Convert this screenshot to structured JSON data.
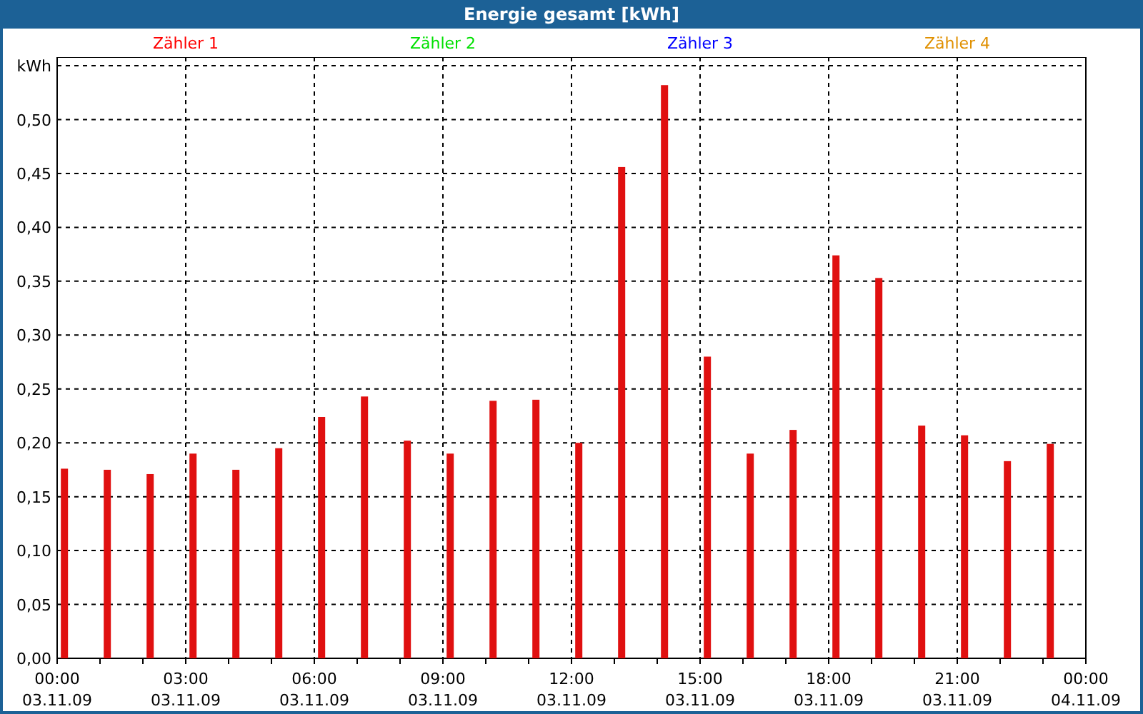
{
  "window": {
    "title": "Energie gesamt [kWh]"
  },
  "legend": [
    {
      "color": "#ff0000"
    },
    {
      "label": "Zähler 2",
      "color": "#00e000"
    },
    {
      "label": "Zähler 3",
      "color": "#0000ff"
    },
    {
      "label": "Zähler 4",
      "color": "#e09000"
    }
  ],
  "chart": {
    "chart_data": {
      "type": "bar",
      "categories": [
        "00:00 03.11.09",
        null,
        null,
        "03:00 03.11.09",
        null,
        null,
        "06:00 03.11.09",
        null,
        null,
        "09:00 03.11.09",
        null,
        null,
        "12:00 03.11.09",
        null,
        null,
        "15:00 03.11.09",
        null,
        null,
        "18:00 03.11.09",
        null,
        null,
        "21:00 03.11.09",
        null,
        null,
        "00:00 04.11.09"
      ],
      "series": [
        {
          "name": "Zähler 1",
          "color": "#e01010",
          "values": [
            0.176,
            0.175,
            0.171,
            0.19,
            0.175,
            0.195,
            0.224,
            0.243,
            0.202,
            0.19,
            0.239,
            0.24,
            0.2,
            0.456,
            0.532,
            0.28,
            0.19,
            0.212,
            0.374,
            0.353,
            0.216,
            0.207,
            0.183,
            0.199,
            null
          ]
        }
      ],
      "ylim": [
        0,
        0.558
      ],
      "grid": true,
      "yticks": [
        {
          "value": 0,
          "label": "0,00"
        },
        {
          "value": 0.05,
          "label": "0,05"
        },
        {
          "value": 0.1,
          "label": "0,10"
        },
        {
          "value": 0.15,
          "label": "0,15"
        },
        {
          "value": 0.2,
          "label": "0,20"
        },
        {
          "value": 0.25,
          "label": "0,25"
        },
        {
          "value": 0.3,
          "label": "0,30"
        },
        {
          "value": 0.35,
          "label": "0,35"
        },
        {
          "value": 0.4,
          "label": "0,40"
        },
        {
          "value": 0.45,
          "label": "0,45"
        },
        {
          "value": 0.5,
          "label": "0,50"
        },
        {
          "value": 0.55,
          "label": "kWh"
        }
      ]
    }
  }
}
